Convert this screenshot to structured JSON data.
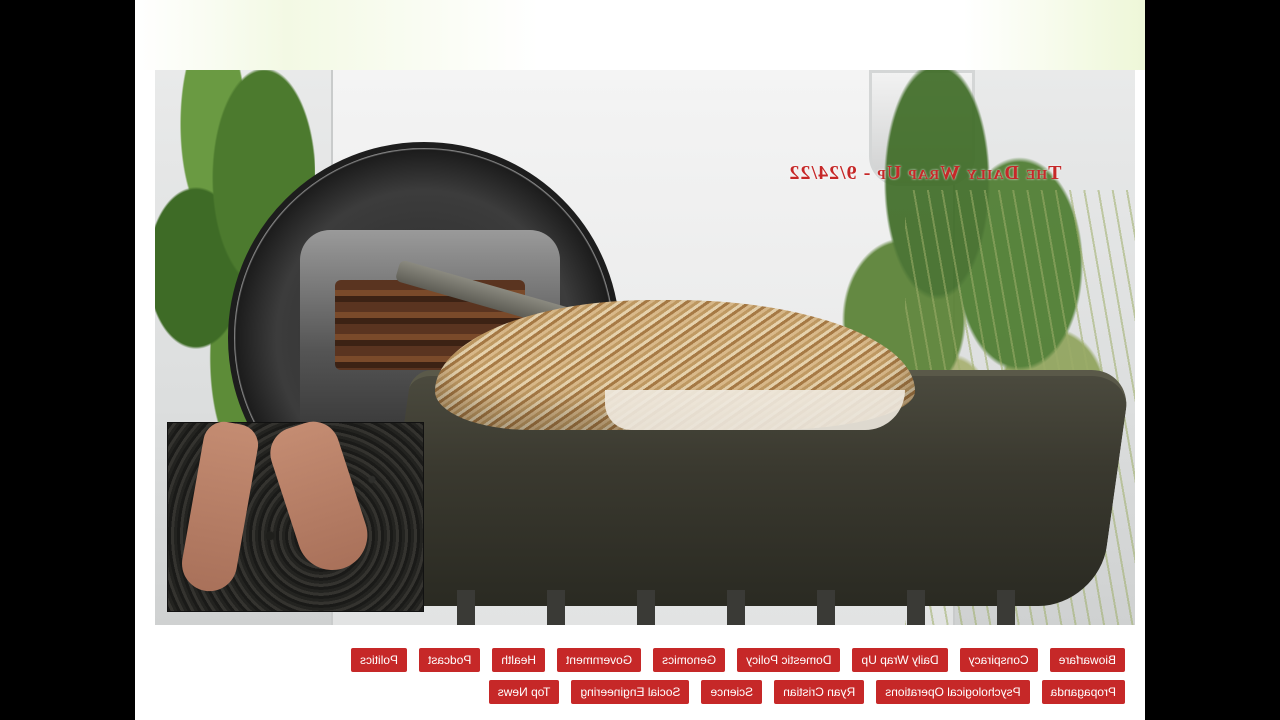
{
  "hero": {
    "title": "The Daily Wrap Up - 9/24/22",
    "image_alt": "Human composting pod with body covered in wood chips; inset of hands holding soil"
  },
  "tags": {
    "row1": [
      "Biowarfare",
      "Conspiracy",
      "Daily Wrap Up",
      "Domestic Policy",
      "Genomics",
      "Government",
      "Health",
      "Podcast",
      "Politics"
    ],
    "row2": [
      "Propaganda",
      "Psychological Operations",
      "Ryan Cristian",
      "Science",
      "Social Engineering",
      "Top News"
    ]
  },
  "colors": {
    "tag_bg": "#c62828",
    "title_color": "#c62828",
    "page_bg": "#000000"
  },
  "display": {
    "mirrored": true
  }
}
